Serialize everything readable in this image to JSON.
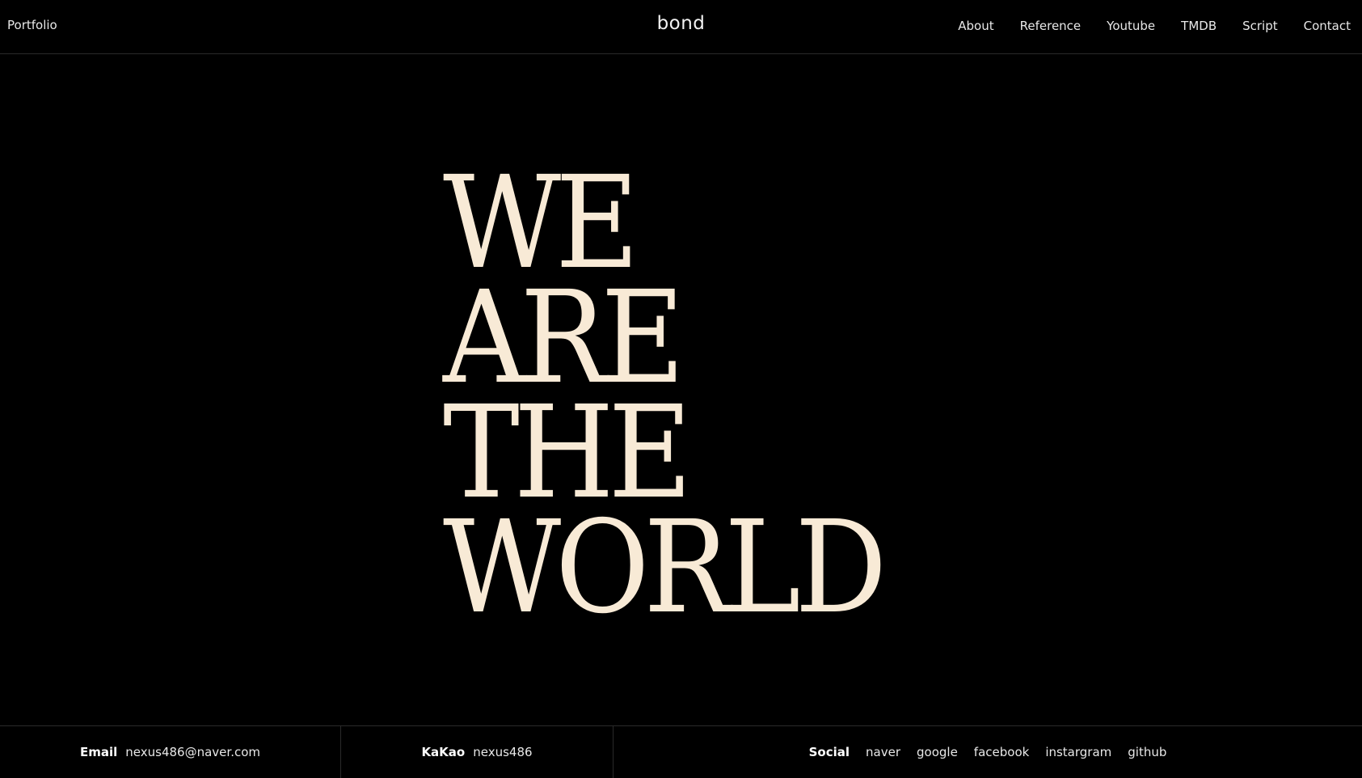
{
  "header": {
    "left_title": "Portfolio",
    "logo": "bond",
    "nav": [
      "About",
      "Reference",
      "Youtube",
      "TMDB",
      "Script",
      "Contact"
    ]
  },
  "hero": {
    "lines": [
      "WE",
      "ARE",
      "THE",
      "WORLD"
    ]
  },
  "footer": {
    "email": {
      "label": "Email",
      "value": "nexus486@naver.com"
    },
    "kakao": {
      "label": "KaKao",
      "value": "nexus486"
    },
    "social": {
      "label": "Social",
      "links": [
        "naver",
        "google",
        "facebook",
        "instargram",
        "github"
      ]
    }
  },
  "colors": {
    "background": "#000000",
    "hero_text": "#f8ead6",
    "divider": "#2a2a2a"
  }
}
